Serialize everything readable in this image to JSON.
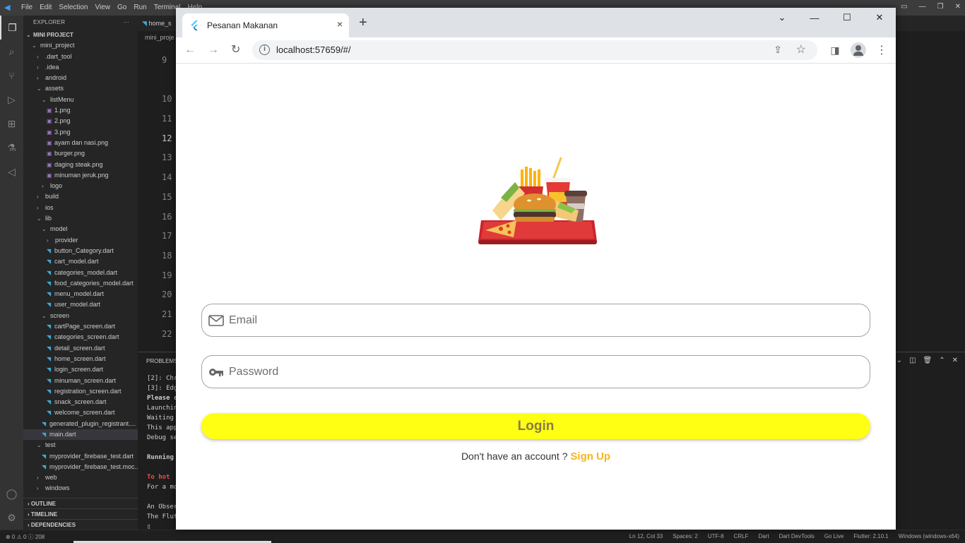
{
  "vscode": {
    "menu": [
      "File",
      "Edit",
      "Selection",
      "View",
      "Go",
      "Run",
      "Terminal",
      "Help"
    ],
    "explorer_title": "EXPLORER",
    "project_label": "MINI PROJECT",
    "tree": [
      {
        "label": "mini_project",
        "indent": 0,
        "kind": "open"
      },
      {
        "label": ".dart_tool",
        "indent": 1,
        "kind": "closed"
      },
      {
        "label": ".idea",
        "indent": 1,
        "kind": "closed"
      },
      {
        "label": "android",
        "indent": 1,
        "kind": "closed"
      },
      {
        "label": "assets",
        "indent": 1,
        "kind": "open"
      },
      {
        "label": "listMenu",
        "indent": 2,
        "kind": "open"
      },
      {
        "label": "1.png",
        "indent": 3,
        "kind": "png"
      },
      {
        "label": "2.png",
        "indent": 3,
        "kind": "png"
      },
      {
        "label": "3.png",
        "indent": 3,
        "kind": "png"
      },
      {
        "label": "ayam dan nasi.png",
        "indent": 3,
        "kind": "png"
      },
      {
        "label": "burger.png",
        "indent": 3,
        "kind": "png"
      },
      {
        "label": "daging steak.png",
        "indent": 3,
        "kind": "png"
      },
      {
        "label": "minuman jeruk.png",
        "indent": 3,
        "kind": "png"
      },
      {
        "label": "logo",
        "indent": 2,
        "kind": "closed"
      },
      {
        "label": "build",
        "indent": 1,
        "kind": "closed"
      },
      {
        "label": "ios",
        "indent": 1,
        "kind": "closed"
      },
      {
        "label": "lib",
        "indent": 1,
        "kind": "open"
      },
      {
        "label": "model",
        "indent": 2,
        "kind": "open"
      },
      {
        "label": "provider",
        "indent": 3,
        "kind": "closed"
      },
      {
        "label": "button_Category.dart",
        "indent": 3,
        "kind": "dart"
      },
      {
        "label": "cart_model.dart",
        "indent": 3,
        "kind": "dart"
      },
      {
        "label": "categories_model.dart",
        "indent": 3,
        "kind": "dart"
      },
      {
        "label": "food_categories_model.dart",
        "indent": 3,
        "kind": "dart"
      },
      {
        "label": "menu_model.dart",
        "indent": 3,
        "kind": "dart"
      },
      {
        "label": "user_model.dart",
        "indent": 3,
        "kind": "dart"
      },
      {
        "label": "screen",
        "indent": 2,
        "kind": "open"
      },
      {
        "label": "cartPage_screen.dart",
        "indent": 3,
        "kind": "dart"
      },
      {
        "label": "categories_screen.dart",
        "indent": 3,
        "kind": "dart"
      },
      {
        "label": "detail_screen.dart",
        "indent": 3,
        "kind": "dart"
      },
      {
        "label": "home_screen.dart",
        "indent": 3,
        "kind": "dart"
      },
      {
        "label": "login_screen.dart",
        "indent": 3,
        "kind": "dart"
      },
      {
        "label": "minuman_screen.dart",
        "indent": 3,
        "kind": "dart"
      },
      {
        "label": "registration_screen.dart",
        "indent": 3,
        "kind": "dart"
      },
      {
        "label": "snack_screen.dart",
        "indent": 3,
        "kind": "dart"
      },
      {
        "label": "welcome_screen.dart",
        "indent": 3,
        "kind": "dart"
      },
      {
        "label": "generated_plugin_registrant....",
        "indent": 2,
        "kind": "dart"
      },
      {
        "label": "main.dart",
        "indent": 2,
        "kind": "dart",
        "selected": true
      },
      {
        "label": "test",
        "indent": 1,
        "kind": "open"
      },
      {
        "label": "myprovider_firebase_test.dart",
        "indent": 2,
        "kind": "dart"
      },
      {
        "label": "myprovider_firebase_test.moc...",
        "indent": 2,
        "kind": "dart"
      },
      {
        "label": "web",
        "indent": 1,
        "kind": "closed"
      },
      {
        "label": "windows",
        "indent": 1,
        "kind": "closed"
      }
    ],
    "sections": [
      "OUTLINE",
      "TIMELINE",
      "DEPENDENCIES"
    ],
    "editor_tab": "home_s",
    "breadcrumb": "mini_proje",
    "line_numbers": [
      "9",
      "",
      "10",
      "11",
      "12",
      "13",
      "14",
      "15",
      "16",
      "17",
      "18",
      "19",
      "20",
      "21",
      "22"
    ],
    "current_line": "12",
    "panel_title": "PROBLEMS",
    "terminal_lines": [
      {
        "text": "[2]: Chr",
        "style": ""
      },
      {
        "text": "[3]: Edg",
        "style": ""
      },
      {
        "text": "Please c",
        "style": "b"
      },
      {
        "text": "Launchin",
        "style": ""
      },
      {
        "text": "Waiting",
        "style": ""
      },
      {
        "text": "This app",
        "style": ""
      },
      {
        "text": "Debug se",
        "style": ""
      },
      {
        "text": "",
        "style": ""
      },
      {
        "text": "Running",
        "style": "b"
      },
      {
        "text": "",
        "style": ""
      },
      {
        "text": " To hot",
        "style": "r"
      },
      {
        "text": "For a mo",
        "style": ""
      },
      {
        "text": "",
        "style": ""
      },
      {
        "text": "An Obser",
        "style": ""
      },
      {
        "text": "The Flut",
        "style": ""
      },
      {
        "text": "▯",
        "style": ""
      }
    ],
    "status_left": [
      "⊗ 0 ⚠ 0 ⓘ 208"
    ],
    "status_right": [
      "Ln 12, Col 33",
      "Spaces: 2",
      "UTF-8",
      "CRLF",
      "Dart",
      "Dart DevTools",
      "Go Live",
      "Flutter: 2.10.1",
      "Windows (windows-x64)"
    ]
  },
  "browser": {
    "tab_title": "Pesanan Makanan",
    "url": "localhost:57659/#/",
    "new_tab": "+",
    "close_tab": "×"
  },
  "app": {
    "image_label": "Food tray illustration",
    "email": {
      "placeholder": "Email",
      "value": ""
    },
    "password": {
      "placeholder": "Password",
      "value": ""
    },
    "login_label": "Login",
    "signup_prompt": "Don't have an account ? ",
    "signup_link": "Sign Up",
    "colors": {
      "button": "#ffff14",
      "link": "#f5b51e",
      "button_text": "#8a7a48"
    }
  }
}
